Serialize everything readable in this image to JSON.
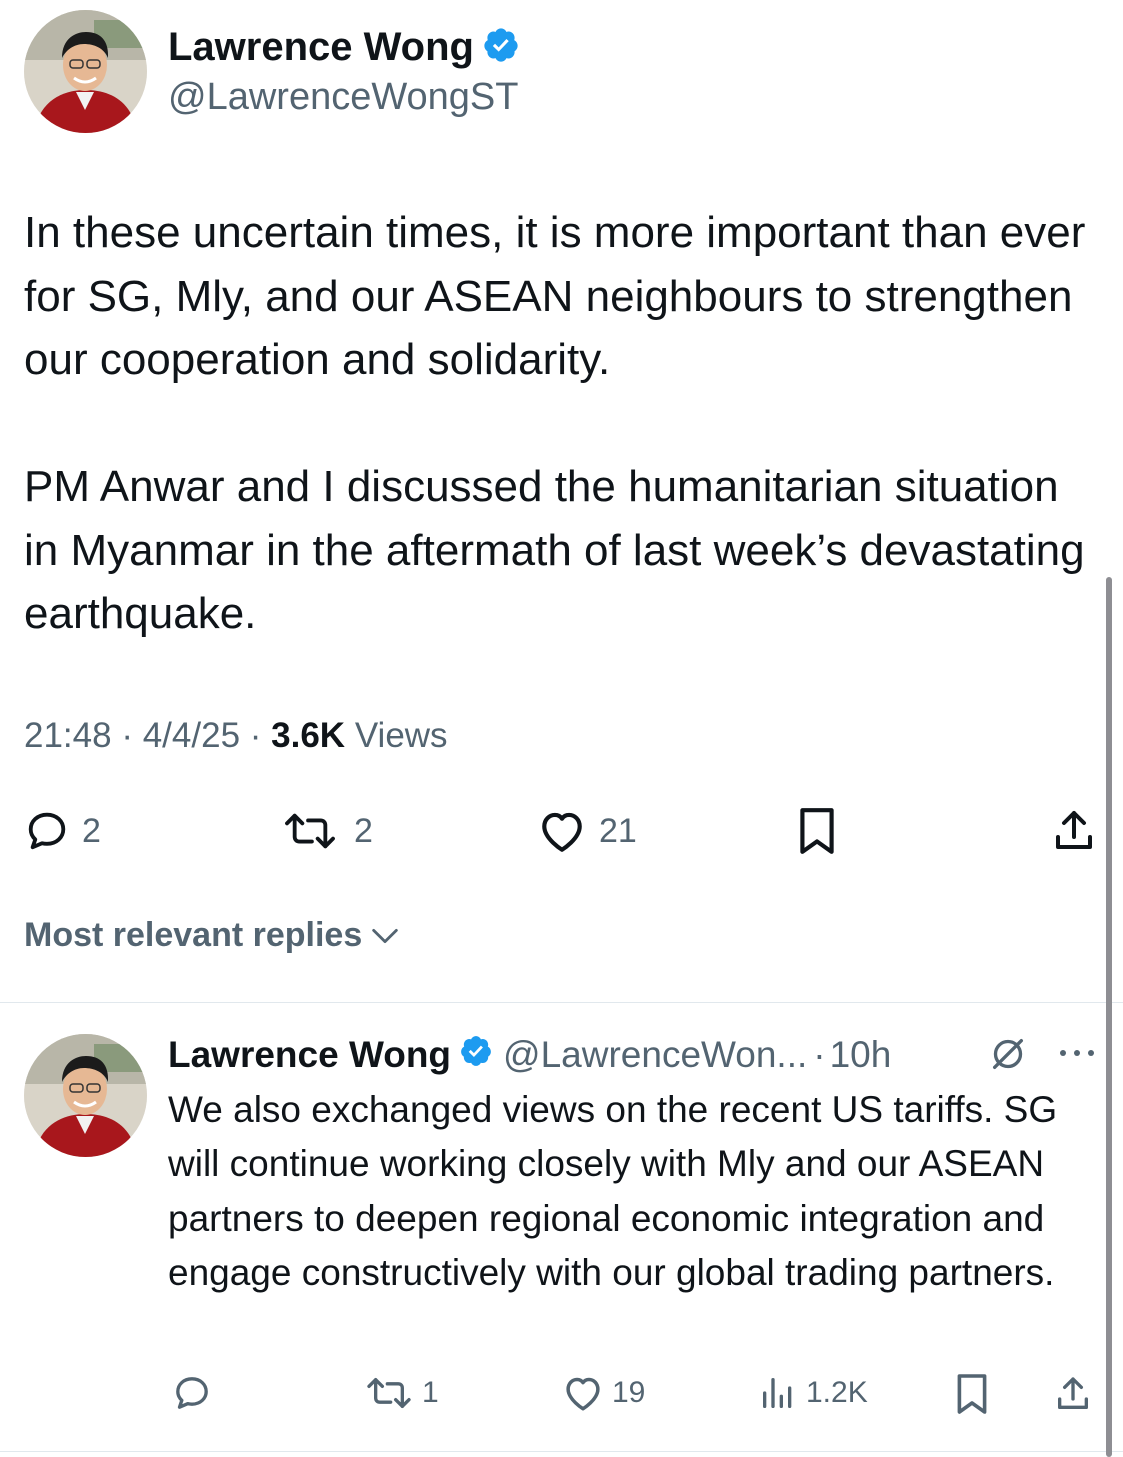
{
  "tweet": {
    "author_name": "Lawrence Wong",
    "author_handle": "@LawrenceWongST",
    "paragraphs": [
      "In these uncertain times, it is more important than ever for SG, Mly, and our ASEAN neighbours to strengthen our cooperation and solidarity.",
      "PM Anwar and I discussed the humanitarian situation in Myanmar in the aftermath of last week’s devastating earthquake."
    ],
    "time": "21:48",
    "date": "4/4/25",
    "separator": "·",
    "views_count": "3.6K",
    "views_label": "Views",
    "actions": {
      "replies": "2",
      "reposts": "2",
      "likes": "21"
    }
  },
  "replies_sort": {
    "label": "Most relevant replies"
  },
  "reply": {
    "author_name": "Lawrence Wong",
    "author_handle": "@LawrenceWon...",
    "separator": "·",
    "time": "10h",
    "text": "We also exchanged views on the recent US tariffs. SG will continue working closely with Mly and our ASEAN partners to deepen regional economic integration and engage constructively with our global trading partners.",
    "actions": {
      "reposts": "1",
      "likes": "19",
      "views": "1.2K"
    }
  },
  "colors": {
    "text_primary": "#0f1419",
    "text_secondary": "#536471",
    "verified_blue": "#1d9bf0",
    "divider": "#e1e8ed"
  },
  "icons": {
    "verified": "verified-badge-icon",
    "reply": "speech-bubble-icon",
    "repost": "repost-arrows-icon",
    "like": "heart-icon",
    "bookmark": "bookmark-icon",
    "share": "share-upload-icon",
    "views": "bar-chart-icon",
    "grok": "grok-slash-icon",
    "more": "more-dots-icon",
    "sort": "chevron-down-icon"
  }
}
